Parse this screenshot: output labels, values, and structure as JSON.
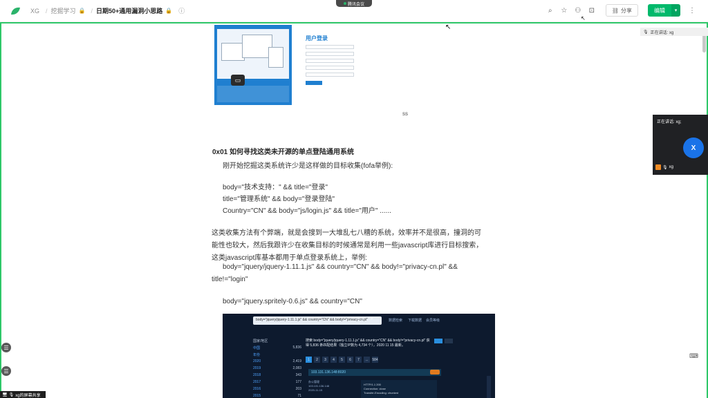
{
  "topbar": {
    "breadcrumbs": [
      "XG",
      "挖掘学习",
      "日期50+通用漏洞小思路"
    ],
    "share_label": "分享",
    "edit_label": "编辑"
  },
  "meeting": {
    "pill_label": "腾讯会议",
    "speaking_label": "正在讲话: xg;",
    "talk_chip": "正在讲话: xg",
    "avatar_letter": "X",
    "participant_name": "xg",
    "screen_share_label": "xg的屏幕共享"
  },
  "doc": {
    "login_title": "用户登录",
    "image_caption": "ss",
    "heading": "0x01 如何寻找这类未开源的单点登陆通用系统",
    "intro": "刚开始挖掘这类系统许少是这样做的目标收集(fofa举例):",
    "queries": [
      "body=\"技术支持：\" && title=\"登录\"",
      "title=\"管理系统\" && body=\"登录登陆\"",
      "Country=\"CN\" && body=\"js/login.js\" && title=\"用户\"   ......"
    ],
    "para_lines": [
      "这类收集方法有个弊端，就是会搜到一大堆乱七八糟的系统，效率并不是很高，撞洞的可",
      "能性也较大，然后我跟许少在收集目标的时候通常是利用一些javascript库进行目标搜索，",
      "这类javascript库基本都用于单点登录系统上，举例:"
    ],
    "example_line1": "body=\"jquery/jquery-1.11.1.js\" && country=\"CN\" && body!=\"privacy-cn.pl\" &&",
    "example_line2": "title!=\"login\"",
    "example2": "body=\"jquery.spritely-0.6.js\" && country=\"CN\""
  },
  "fofa_shot": {
    "search_text": "body=\"jquery/jquery-1.11.1.js\" && country=\"CN\" && body!=\"privacy-cn.pl\"",
    "nav": [
      "数据检索",
      "下载数据",
      "会员等级"
    ],
    "side_header": "国家/地区",
    "side_rows": [
      {
        "k": "中国",
        "v": "5,836"
      },
      {
        "k": "年份",
        "v": ""
      },
      {
        "k": "2020",
        "v": "2,419"
      },
      {
        "k": "2019",
        "v": "2,083"
      },
      {
        "k": "2018",
        "v": "343"
      },
      {
        "k": "2017",
        "v": "177"
      },
      {
        "k": "2016",
        "v": "203"
      },
      {
        "k": "2015",
        "v": "71"
      }
    ],
    "title_text": "搜索 body=\"jquery/jquery-1.11.1.js\" && country=\"CN\" && body!=\"privacy-cn.pl\" 获得 5,836 条匹配结果（独立IP数为 4,734 个），2020 11 15 最新。",
    "pages": [
      "1",
      "2",
      "3",
      "4",
      "5",
      "6",
      "7",
      "...",
      "584"
    ],
    "active_page": "1",
    "result_host": "103.131.136.148:8020",
    "detail_lines": [
      "办公管理",
      "103.131.136.148",
      "2020-11-15"
    ],
    "detail2_lines": [
      "HTTP/1.1 200",
      "Connection: close",
      "Transfer-Encoding: chunked"
    ]
  }
}
